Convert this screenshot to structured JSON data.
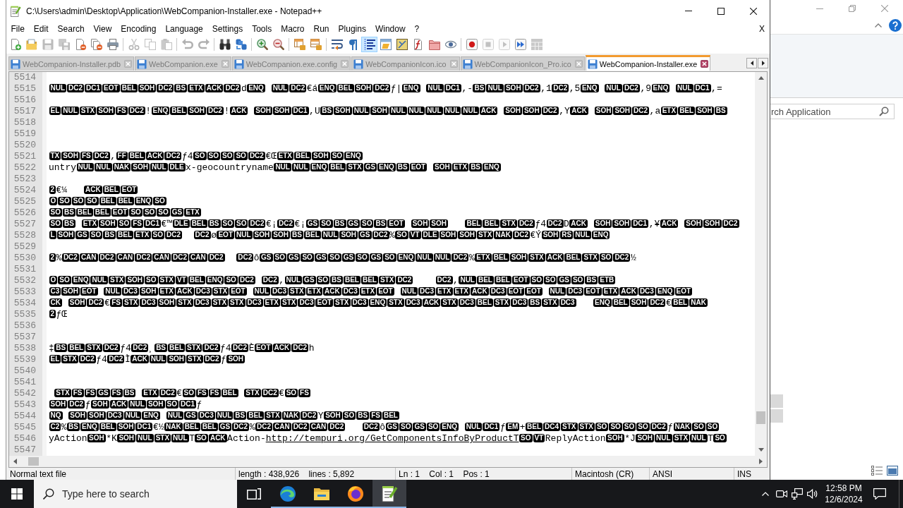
{
  "window": {
    "title": "C:\\Users\\admin\\Desktop\\Application\\WebCompanion-Installer.exe - Notepad++"
  },
  "menu": {
    "items": [
      "File",
      "Edit",
      "Search",
      "View",
      "Encoding",
      "Language",
      "Settings",
      "Tools",
      "Macro",
      "Run",
      "Plugins",
      "Window",
      "?"
    ],
    "close_label": "X"
  },
  "toolbar": [
    [
      {
        "kind": "new",
        "disabled": false,
        "on": false
      },
      {
        "kind": "open",
        "disabled": false,
        "on": false
      },
      {
        "kind": "save",
        "disabled": true,
        "on": false
      },
      {
        "kind": "save_all",
        "disabled": true,
        "on": false
      },
      {
        "kind": "close",
        "disabled": false,
        "on": false
      },
      {
        "kind": "close_all",
        "disabled": false,
        "on": false
      },
      {
        "kind": "print",
        "disabled": false,
        "on": false
      }
    ],
    [
      {
        "kind": "cut",
        "disabled": true,
        "on": false
      },
      {
        "kind": "copy",
        "disabled": true,
        "on": false
      },
      {
        "kind": "paste",
        "disabled": true,
        "on": false
      }
    ],
    [
      {
        "kind": "undo",
        "disabled": true,
        "on": false
      },
      {
        "kind": "redo",
        "disabled": true,
        "on": false
      }
    ],
    [
      {
        "kind": "find",
        "disabled": false,
        "on": false
      },
      {
        "kind": "replace",
        "disabled": false,
        "on": false
      }
    ],
    [
      {
        "kind": "zoom_in",
        "disabled": false,
        "on": false
      },
      {
        "kind": "zoom_out",
        "disabled": false,
        "on": false
      }
    ],
    [
      {
        "kind": "sync_vertical",
        "disabled": false,
        "on": false
      },
      {
        "kind": "sync_horizontal",
        "disabled": false,
        "on": false
      }
    ],
    [
      {
        "kind": "word_wrap",
        "disabled": false,
        "on": false
      },
      {
        "kind": "all_characters",
        "disabled": false,
        "on": false
      },
      {
        "kind": "indent_guide",
        "disabled": false,
        "on": true
      },
      {
        "kind": "language",
        "disabled": false,
        "on": false
      },
      {
        "kind": "document_map",
        "disabled": false,
        "on": false
      },
      {
        "kind": "function_list",
        "disabled": false,
        "on": false
      },
      {
        "kind": "folder_workspace",
        "disabled": false,
        "on": false
      },
      {
        "kind": "monitoring",
        "disabled": false,
        "on": false
      }
    ],
    [
      {
        "kind": "record",
        "disabled": false,
        "on": false
      },
      {
        "kind": "stop",
        "disabled": true,
        "on": false
      },
      {
        "kind": "play",
        "disabled": true,
        "on": false
      },
      {
        "kind": "run_multiple",
        "disabled": false,
        "on": false
      },
      {
        "kind": "save_macro",
        "disabled": true,
        "on": false
      }
    ]
  ],
  "tabs": [
    {
      "label": "WebCompanion-Installer.pdb",
      "selected": false
    },
    {
      "label": "WebCompanion.exe",
      "selected": false
    },
    {
      "label": "WebCompanion.exe.config",
      "selected": false
    },
    {
      "label": "WebCompanionIcon.ico",
      "selected": false
    },
    {
      "label": "WebCompanionIcon_Pro.ico",
      "selected": false
    },
    {
      "label": "WebCompanion-Installer.exe",
      "selected": true
    }
  ],
  "editor": {
    "lines": [
      {
        "number": "5514"
      },
      {
        "number": "5515",
        "segments": [
          {
            "kind": "ctrl",
            "codes": [
              "NUL",
              "DC2",
              "DC1",
              "EOT",
              "BEL",
              "SOH",
              "DC2",
              "BS",
              "ETX",
              "ACK",
              "DC2"
            ]
          },
          {
            "kind": "text",
            "text": "d"
          },
          {
            "kind": "ctrl",
            "codes": [
              "ENQ"
            ]
          },
          {
            "kind": "space"
          },
          {
            "kind": "ctrl",
            "codes": [
              "NUL",
              "DC2"
            ]
          },
          {
            "kind": "text",
            "text": "€á"
          },
          {
            "kind": "ctrl",
            "codes": [
              "ENQ",
              "BEL",
              "SOH",
              "DC2"
            ]
          },
          {
            "kind": "text",
            "text": "ƒ|"
          },
          {
            "kind": "ctrl",
            "codes": [
              "ENQ"
            ]
          },
          {
            "kind": "space"
          },
          {
            "kind": "ctrl",
            "codes": [
              "NUL",
              "DC1"
            ]
          },
          {
            "kind": "text",
            "text": ",-"
          },
          {
            "kind": "ctrl",
            "codes": [
              "BS",
              "NUL",
              "SOH",
              "DC2"
            ]
          },
          {
            "kind": "text",
            "text": ",1"
          },
          {
            "kind": "ctrl",
            "codes": [
              "DC2"
            ]
          },
          {
            "kind": "text",
            "text": ",5"
          },
          {
            "kind": "ctrl",
            "codes": [
              "ENQ"
            ]
          },
          {
            "kind": "space"
          },
          {
            "kind": "ctrl",
            "codes": [
              "NUL",
              "DC2"
            ]
          },
          {
            "kind": "text",
            "text": ",9"
          },
          {
            "kind": "ctrl",
            "codes": [
              "ENQ"
            ]
          },
          {
            "kind": "space"
          },
          {
            "kind": "ctrl",
            "codes": [
              "NUL",
              "DC1"
            ]
          },
          {
            "kind": "text",
            "text": ",="
          }
        ]
      },
      {
        "number": "5516"
      },
      {
        "number": "5517",
        "segments": [
          {
            "kind": "ctrl",
            "codes": [
              "EL",
              "NUL",
              "STX",
              "SOH",
              "FS",
              "DC2"
            ]
          },
          {
            "kind": "text",
            "text": "!"
          },
          {
            "kind": "ctrl",
            "codes": [
              "ENQ",
              "BEL",
              "SOH",
              "DC2"
            ]
          },
          {
            "kind": "text",
            "text": "!"
          },
          {
            "kind": "ctrl",
            "codes": [
              "ACK"
            ]
          },
          {
            "kind": "space"
          },
          {
            "kind": "ctrl",
            "codes": [
              "SOH",
              "SOH",
              "DC1"
            ]
          },
          {
            "kind": "text",
            "text": ",U"
          },
          {
            "kind": "ctrl",
            "codes": [
              "BS",
              "SOH",
              "NUL",
              "SOH",
              "NUL",
              "NUL",
              "NUL",
              "NUL",
              "NUL",
              "ACK"
            ]
          },
          {
            "kind": "space"
          },
          {
            "kind": "ctrl",
            "codes": [
              "SOH",
              "SOH",
              "DC2"
            ]
          },
          {
            "kind": "text",
            "text": ",Y"
          },
          {
            "kind": "ctrl",
            "codes": [
              "ACK"
            ]
          },
          {
            "kind": "space"
          },
          {
            "kind": "ctrl",
            "codes": [
              "SOH",
              "SOH",
              "DC2"
            ]
          },
          {
            "kind": "text",
            "text": ",a"
          },
          {
            "kind": "ctrl",
            "codes": [
              "ETX",
              "BEL",
              "SOH",
              "BS"
            ]
          }
        ]
      },
      {
        "number": "5518"
      },
      {
        "number": "5519"
      },
      {
        "number": "5520"
      },
      {
        "number": "5521",
        "segments": [
          {
            "kind": "ctrl",
            "codes": [
              "TX",
              "SOH",
              "FS",
              "DC2"
            ]
          },
          {
            "kind": "text",
            "text": ","
          },
          {
            "kind": "ctrl",
            "codes": [
              "FF",
              "BEL",
              "ACK",
              "DC2"
            ]
          },
          {
            "kind": "text",
            "text": "ƒ4"
          },
          {
            "kind": "ctrl",
            "codes": [
              "SO",
              "SO",
              "SO",
              "SO",
              "DC2"
            ]
          },
          {
            "kind": "text",
            "text": "€Œ"
          },
          {
            "kind": "ctrl",
            "codes": [
              "ETX",
              "BEL",
              "SOH",
              "SO",
              "ENQ"
            ]
          }
        ]
      },
      {
        "number": "5522",
        "segments": [
          {
            "kind": "text",
            "text": "untry"
          },
          {
            "kind": "ctrl",
            "codes": [
              "NUL",
              "NUL",
              "NAK",
              "SOH",
              "NUL",
              "DLE"
            ]
          },
          {
            "kind": "text",
            "text": "x-geocountryname"
          },
          {
            "kind": "ctrl",
            "codes": [
              "NUL",
              "NUL",
              "ENQ",
              "BEL",
              "STX",
              "GS",
              "ENQ",
              "BS",
              "EOT"
            ]
          },
          {
            "kind": "space"
          },
          {
            "kind": "ctrl",
            "codes": [
              "SOH",
              "ETX",
              "BS",
              "ENQ"
            ]
          }
        ]
      },
      {
        "number": "5523"
      },
      {
        "number": "5524",
        "segments": [
          {
            "kind": "ctrl",
            "codes": [
              "2"
            ]
          },
          {
            "kind": "text",
            "text": "€¼"
          },
          {
            "kind": "space"
          },
          {
            "kind": "space"
          },
          {
            "kind": "space"
          },
          {
            "kind": "ctrl",
            "codes": [
              "ACK",
              "BEL",
              "EOT"
            ]
          }
        ]
      },
      {
        "number": "5525",
        "segments": [
          {
            "kind": "ctrl",
            "codes": [
              "O",
              "SO",
              "SO",
              "SO",
              "BEL",
              "BEL",
              "ENQ",
              "SO"
            ]
          }
        ]
      },
      {
        "number": "5526",
        "segments": [
          {
            "kind": "ctrl",
            "codes": [
              "SO",
              "BS",
              "BEL",
              "BEL",
              "EOT",
              "SO",
              "SO",
              "SO",
              "GS",
              "ETX"
            ]
          }
        ]
      },
      {
        "number": "5527",
        "segments": [
          {
            "kind": "ctrl",
            "codes": [
              "SO",
              "BS"
            ]
          },
          {
            "kind": "space"
          },
          {
            "kind": "ctrl",
            "codes": [
              "ETX",
              "SOH",
              "SO",
              "FS",
              "DC1"
            ]
          },
          {
            "kind": "text",
            "text": "€™"
          },
          {
            "kind": "ctrl",
            "codes": [
              "DLE",
              "BEL",
              "BS",
              "SO",
              "SO",
              "DC2"
            ]
          },
          {
            "kind": "text",
            "text": "€¡"
          },
          {
            "kind": "ctrl",
            "codes": [
              "DC2"
            ]
          },
          {
            "kind": "text",
            "text": "€¡"
          },
          {
            "kind": "ctrl",
            "codes": [
              "GS",
              "SO",
              "BS",
              "GS",
              "SO",
              "BS",
              "EOT"
            ]
          },
          {
            "kind": "space"
          },
          {
            "kind": "ctrl",
            "codes": [
              "SOH",
              "SOH"
            ]
          },
          {
            "kind": "space"
          },
          {
            "kind": "space"
          },
          {
            "kind": "space"
          },
          {
            "kind": "ctrl",
            "codes": [
              "BEL",
              "BEL",
              "STX",
              "DC2"
            ]
          },
          {
            "kind": "text",
            "text": "ƒ4"
          },
          {
            "kind": "ctrl",
            "codes": [
              "DC2"
            ]
          },
          {
            "kind": "text",
            "text": "D"
          },
          {
            "kind": "ctrl",
            "codes": [
              "ACK"
            ]
          },
          {
            "kind": "space"
          },
          {
            "kind": "ctrl",
            "codes": [
              "SOH",
              "SOH",
              "DC1"
            ]
          },
          {
            "kind": "text",
            "text": ",¥"
          },
          {
            "kind": "ctrl",
            "codes": [
              "ACK"
            ]
          },
          {
            "kind": "space"
          },
          {
            "kind": "ctrl",
            "codes": [
              "SOH",
              "SOH",
              "DC2"
            ]
          }
        ]
      },
      {
        "number": "5528",
        "segments": [
          {
            "kind": "ctrl",
            "codes": [
              "L",
              "SOH",
              "GS",
              "SO",
              "BS",
              "BEL",
              "ETX",
              "SO",
              "DC2"
            ]
          },
          {
            "kind": "space"
          },
          {
            "kind": "space"
          },
          {
            "kind": "ctrl",
            "codes": [
              "DC2"
            ]
          },
          {
            "kind": "text",
            "text": "ø"
          },
          {
            "kind": "ctrl",
            "codes": [
              "EOT",
              "NUL",
              "SOH",
              "SOH",
              "BS",
              "BEL",
              "NUL",
              "SOH",
              "GS",
              "DC2"
            ]
          },
          {
            "kind": "text",
            "text": "%"
          },
          {
            "kind": "ctrl",
            "codes": [
              "SO",
              "VT",
              "DLE",
              "SOH",
              "SOH",
              "STX",
              "NAK",
              "DC2"
            ]
          },
          {
            "kind": "text",
            "text": "€Ý"
          },
          {
            "kind": "ctrl",
            "codes": [
              "SOH",
              "RS",
              "NUL",
              "ENQ"
            ]
          }
        ]
      },
      {
        "number": "5529"
      },
      {
        "number": "5530",
        "segments": [
          {
            "kind": "ctrl",
            "codes": [
              "2"
            ]
          },
          {
            "kind": "text",
            "text": "%"
          },
          {
            "kind": "ctrl",
            "codes": [
              "DC2",
              "CAN",
              "DC2",
              "CAN",
              "DC2",
              "CAN",
              "DC2",
              "CAN",
              "DC2"
            ]
          },
          {
            "kind": "space"
          },
          {
            "kind": "space"
          },
          {
            "kind": "ctrl",
            "codes": [
              "DC2"
            ]
          },
          {
            "kind": "text",
            "text": "ô"
          },
          {
            "kind": "ctrl",
            "codes": [
              "GS",
              "SO",
              "GS",
              "SO",
              "GS",
              "SO",
              "GS",
              "SO",
              "GS",
              "SO",
              "ENQ",
              "NUL",
              "NUL",
              "DC2"
            ]
          },
          {
            "kind": "text",
            "text": "%"
          },
          {
            "kind": "ctrl",
            "codes": [
              "ETX",
              "BEL",
              "SOH",
              "STX",
              "ACK",
              "BEL",
              "STX",
              "SO",
              "DC2"
            ]
          },
          {
            "kind": "text",
            "text": "½"
          }
        ]
      },
      {
        "number": "5531"
      },
      {
        "number": "5532",
        "segments": [
          {
            "kind": "ctrl",
            "codes": [
              "O",
              "SO",
              "ENQ",
              "NUL",
              "STX",
              "SOH",
              "SO",
              "STX",
              "VT",
              "BEL",
              "ENQ",
              "SO",
              "DC2"
            ]
          },
          {
            "kind": "space"
          },
          {
            "kind": "ctrl",
            "codes": [
              "DC2"
            ]
          },
          {
            "kind": "text",
            "text": ","
          },
          {
            "kind": "ctrl",
            "codes": [
              "NUL",
              "GS",
              "SO",
              "BS",
              "BEL",
              "BEL",
              "STX",
              "DC2"
            ]
          },
          {
            "kind": "space"
          },
          {
            "kind": "space"
          },
          {
            "kind": "space"
          },
          {
            "kind": "space"
          },
          {
            "kind": "ctrl",
            "codes": [
              "DC2"
            ]
          },
          {
            "kind": "text",
            "text": ","
          },
          {
            "kind": "ctrl",
            "codes": [
              "NUL",
              "BEL",
              "BEL",
              "EOT",
              "SO",
              "SO",
              "GS",
              "SO",
              "BS",
              "ETB"
            ]
          }
        ]
      },
      {
        "number": "5533",
        "segments": [
          {
            "kind": "ctrl",
            "codes": [
              "C3",
              "SOH",
              "EOT"
            ]
          },
          {
            "kind": "space"
          },
          {
            "kind": "ctrl",
            "codes": [
              "NUL",
              "DC3",
              "SOH",
              "ETX",
              "ACK",
              "DC3",
              "STX",
              "EOT"
            ]
          },
          {
            "kind": "space"
          },
          {
            "kind": "ctrl",
            "codes": [
              "NUL",
              "DC3",
              "STX",
              "ETX",
              "ACK",
              "DC3",
              "ETX",
              "EOT"
            ]
          },
          {
            "kind": "space"
          },
          {
            "kind": "ctrl",
            "codes": [
              "NUL",
              "DC3",
              "ETX",
              "ETX",
              "ACK",
              "DC3",
              "EOT",
              "EOT"
            ]
          },
          {
            "kind": "space"
          },
          {
            "kind": "ctrl",
            "codes": [
              "NUL",
              "DC3",
              "EOT",
              "ETX",
              "ACK",
              "DC3",
              "ENQ",
              "EOT"
            ]
          }
        ]
      },
      {
        "number": "5534",
        "segments": [
          {
            "kind": "ctrl",
            "codes": [
              "CK"
            ]
          },
          {
            "kind": "space"
          },
          {
            "kind": "ctrl",
            "codes": [
              "SOH",
              "DC2"
            ]
          },
          {
            "kind": "text",
            "text": "€"
          },
          {
            "kind": "ctrl",
            "codes": [
              "FS",
              "STX",
              "DC3",
              "SOH",
              "STX",
              "DC3",
              "STX",
              "STX",
              "DC3",
              "ETX",
              "STX",
              "DC3",
              "EOT",
              "STX",
              "DC3",
              "ENQ",
              "STX",
              "DC3",
              "ACK",
              "STX",
              "DC3",
              "BEL",
              "STX",
              "DC3",
              "BS",
              "STX",
              "DC3"
            ]
          },
          {
            "kind": "space"
          },
          {
            "kind": "space"
          },
          {
            "kind": "space"
          },
          {
            "kind": "ctrl",
            "codes": [
              "ENQ",
              "BEL",
              "SOH",
              "DC2"
            ]
          },
          {
            "kind": "text",
            "text": "€"
          },
          {
            "kind": "ctrl",
            "codes": [
              "BEL",
              "NAK"
            ]
          }
        ]
      },
      {
        "number": "5535",
        "segments": [
          {
            "kind": "ctrl",
            "codes": [
              "2"
            ]
          },
          {
            "kind": "text",
            "text": "ƒŒ"
          }
        ]
      },
      {
        "number": "5536"
      },
      {
        "number": "5537"
      },
      {
        "number": "5538",
        "segments": [
          {
            "kind": "text",
            "text": "‡"
          },
          {
            "kind": "ctrl",
            "codes": [
              "BS",
              "BEL",
              "STX",
              "DC2"
            ]
          },
          {
            "kind": "text",
            "text": "ƒ4"
          },
          {
            "kind": "ctrl",
            "codes": [
              "DC2"
            ]
          },
          {
            "kind": "text",
            "text": "¸"
          },
          {
            "kind": "ctrl",
            "codes": [
              "BS",
              "BEL",
              "STX",
              "DC2"
            ]
          },
          {
            "kind": "text",
            "text": "ƒ4"
          },
          {
            "kind": "ctrl",
            "codes": [
              "DC2"
            ]
          },
          {
            "kind": "text",
            "text": "È"
          },
          {
            "kind": "ctrl",
            "codes": [
              "EOT",
              "ACK",
              "DC2"
            ]
          },
          {
            "kind": "text",
            "text": "h"
          }
        ]
      },
      {
        "number": "5539",
        "segments": [
          {
            "kind": "ctrl",
            "codes": [
              "EL",
              "STX",
              "DC2"
            ]
          },
          {
            "kind": "text",
            "text": "ƒ4"
          },
          {
            "kind": "ctrl",
            "codes": [
              "DC2"
            ]
          },
          {
            "kind": "text",
            "text": "Ì"
          },
          {
            "kind": "ctrl",
            "codes": [
              "ACK",
              "NUL",
              "SOH",
              "STX",
              "DC2"
            ]
          },
          {
            "kind": "text",
            "text": "ƒ"
          },
          {
            "kind": "ctrl",
            "codes": [
              "SOH"
            ]
          }
        ]
      },
      {
        "number": "5540"
      },
      {
        "number": "5541"
      },
      {
        "number": "5542",
        "segments": [
          {
            "kind": "space"
          },
          {
            "kind": "ctrl",
            "codes": [
              "STX",
              "FS",
              "FS",
              "GS",
              "FS",
              "BS"
            ]
          },
          {
            "kind": "space"
          },
          {
            "kind": "ctrl",
            "codes": [
              "ETX",
              "DC2"
            ]
          },
          {
            "kind": "text",
            "text": "€"
          },
          {
            "kind": "ctrl",
            "codes": [
              "SO",
              "FS",
              "FS",
              "BEL"
            ]
          },
          {
            "kind": "space"
          },
          {
            "kind": "ctrl",
            "codes": [
              "STX",
              "DC2"
            ]
          },
          {
            "kind": "text",
            "text": "€"
          },
          {
            "kind": "ctrl",
            "codes": [
              "SO",
              "FS"
            ]
          }
        ]
      },
      {
        "number": "5543",
        "segments": [
          {
            "kind": "ctrl",
            "codes": [
              "SOH",
              "DC2"
            ]
          },
          {
            "kind": "text",
            "text": "ƒ"
          },
          {
            "kind": "ctrl",
            "codes": [
              "SOH",
              "ACK",
              "NUL",
              "SOH",
              "SO",
              "DC1"
            ]
          },
          {
            "kind": "text",
            "text": "ƒ"
          }
        ]
      },
      {
        "number": "5544",
        "segments": [
          {
            "kind": "ctrl",
            "codes": [
              "NQ"
            ]
          },
          {
            "kind": "space"
          },
          {
            "kind": "ctrl",
            "codes": [
              "SOH",
              "SOH",
              "DC3",
              "NUL",
              "ENQ"
            ]
          },
          {
            "kind": "space"
          },
          {
            "kind": "ctrl",
            "codes": [
              "NUL",
              "GS",
              "DC3",
              "NUL",
              "BS",
              "BEL",
              "STX",
              "NAK",
              "DC2"
            ]
          },
          {
            "kind": "text",
            "text": "Y"
          },
          {
            "kind": "ctrl",
            "codes": [
              "SOH",
              "SO",
              "BS",
              "FS",
              "BEL"
            ]
          }
        ]
      },
      {
        "number": "5545",
        "segments": [
          {
            "kind": "ctrl",
            "codes": [
              "C2"
            ]
          },
          {
            "kind": "text",
            "text": "%"
          },
          {
            "kind": "ctrl",
            "codes": [
              "BS",
              "ENQ",
              "BEL",
              "SOH",
              "DC1"
            ]
          },
          {
            "kind": "text",
            "text": "€½"
          },
          {
            "kind": "ctrl",
            "codes": [
              "NAK",
              "BEL",
              "BEL",
              "GS",
              "DC2"
            ]
          },
          {
            "kind": "text",
            "text": "%"
          },
          {
            "kind": "ctrl",
            "codes": [
              "DC2",
              "CAN",
              "DC2",
              "CAN",
              "DC2"
            ]
          },
          {
            "kind": "space"
          },
          {
            "kind": "space"
          },
          {
            "kind": "space"
          },
          {
            "kind": "ctrl",
            "codes": [
              "DC2"
            ]
          },
          {
            "kind": "text",
            "text": "ô"
          },
          {
            "kind": "ctrl",
            "codes": [
              "GS",
              "SO",
              "GS",
              "SO",
              "ENQ"
            ]
          },
          {
            "kind": "space"
          },
          {
            "kind": "ctrl",
            "codes": [
              "NUL",
              "DC1"
            ]
          },
          {
            "kind": "text",
            "text": "ƒ"
          },
          {
            "kind": "ctrl",
            "codes": [
              "EM"
            ]
          },
          {
            "kind": "text",
            "text": "+"
          },
          {
            "kind": "ctrl",
            "codes": [
              "BEL",
              "DC4",
              "STX",
              "STX",
              "SO",
              "SO",
              "SO",
              "SO",
              "DC2"
            ]
          },
          {
            "kind": "text",
            "text": "ƒ"
          },
          {
            "kind": "ctrl",
            "codes": [
              "NAK",
              "SO",
              "SO"
            ]
          }
        ]
      },
      {
        "number": "5546",
        "segments": [
          {
            "kind": "text",
            "text": "yAction"
          },
          {
            "kind": "ctrl",
            "codes": [
              "SOH"
            ]
          },
          {
            "kind": "text",
            "text": "*K"
          },
          {
            "kind": "ctrl",
            "codes": [
              "SOH",
              "NUL",
              "STX",
              "NUL"
            ]
          },
          {
            "kind": "text",
            "text": "T"
          },
          {
            "kind": "ctrl",
            "codes": [
              "SO",
              "ACK"
            ]
          },
          {
            "kind": "text",
            "text": "Action-"
          },
          {
            "kind": "link",
            "text": "http://tempuri.org/GetComponentsInfoByProductT"
          },
          {
            "kind": "ctrl",
            "codes": [
              "SO",
              "VT"
            ]
          },
          {
            "kind": "text",
            "text": "ReplyAction"
          },
          {
            "kind": "ctrl",
            "codes": [
              "SOH"
            ]
          },
          {
            "kind": "text",
            "text": "*J"
          },
          {
            "kind": "ctrl",
            "codes": [
              "SOH",
              "NUL",
              "STX",
              "NUL"
            ]
          },
          {
            "kind": "text",
            "text": "T"
          },
          {
            "kind": "ctrl",
            "codes": [
              "SO"
            ]
          }
        ]
      },
      {
        "number": "5547"
      }
    ]
  },
  "status_bar": [
    "Normal text file",
    "length : 438,926    lines : 5,892",
    "Ln : 1    Col : 1    Pos : 1",
    "Macintosh (CR)",
    "ANSI",
    "INS"
  ],
  "background_window": {
    "search": {
      "placeholder": "rch Application"
    }
  },
  "taskbar": {
    "search": {
      "placeholder": "Type here to search"
    },
    "apps": [
      {
        "kind": "wave_browser",
        "running": true,
        "active": false
      },
      {
        "kind": "file_folder",
        "running": true,
        "active": false
      },
      {
        "kind": "fox_browser",
        "running": true,
        "active": false
      },
      {
        "kind": "text_editor",
        "running": true,
        "active": true
      }
    ],
    "clock": {
      "time": "12:58 PM",
      "date": "12/6/2024"
    }
  }
}
